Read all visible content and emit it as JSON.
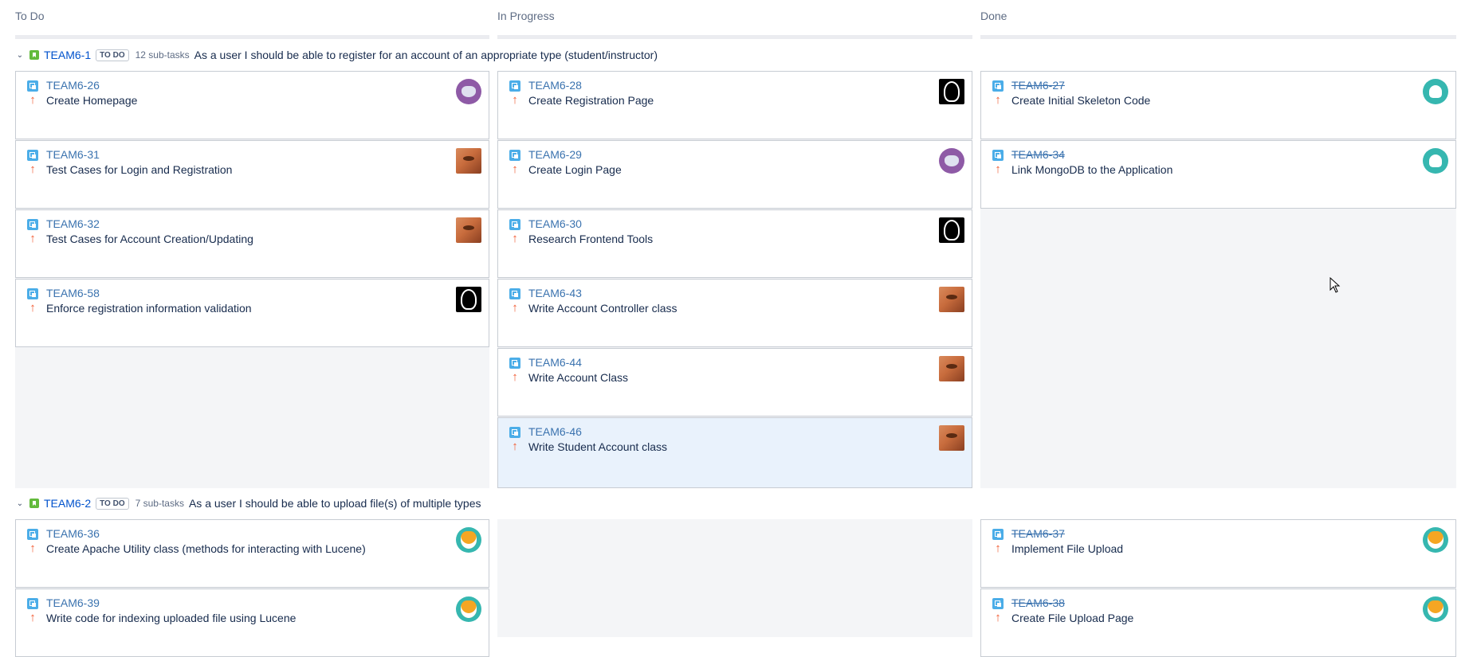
{
  "columns": [
    {
      "title": "To Do"
    },
    {
      "title": "In Progress"
    },
    {
      "title": "Done"
    }
  ],
  "swimlanes": [
    {
      "key": "TEAM6-1",
      "status": "TO DO",
      "subtasks": "12 sub-tasks",
      "summary": "As a user I should be able to register for an account of an appropriate type (student/instructor)"
    },
    {
      "key": "TEAM6-2",
      "status": "TO DO",
      "subtasks": "7 sub-tasks",
      "summary": "As a user I should be able to upload file(s) of multiple types"
    }
  ],
  "lane1": {
    "todo": [
      {
        "key": "TEAM6-26",
        "summary": "Create Homepage",
        "avatar": "cat-avatar"
      },
      {
        "key": "TEAM6-31",
        "summary": "Test Cases for Login and Registration",
        "avatar": "face-photo-avatar"
      },
      {
        "key": "TEAM6-32",
        "summary": "Test Cases for Account Creation/Updating",
        "avatar": "face-photo-avatar"
      },
      {
        "key": "TEAM6-58",
        "summary": "Enforce registration information validation",
        "avatar": "sketch-photo-avatar"
      }
    ],
    "inprogress": [
      {
        "key": "TEAM6-28",
        "summary": "Create Registration Page",
        "avatar": "sketch-photo-avatar"
      },
      {
        "key": "TEAM6-29",
        "summary": "Create Login Page",
        "avatar": "cat-avatar"
      },
      {
        "key": "TEAM6-30",
        "summary": "Research Frontend Tools",
        "avatar": "sketch-photo-avatar"
      },
      {
        "key": "TEAM6-43",
        "summary": "Write Account Controller class",
        "avatar": "face-photo-avatar"
      },
      {
        "key": "TEAM6-44",
        "summary": "Write Account Class",
        "avatar": "face-photo-avatar"
      },
      {
        "key": "TEAM6-46",
        "summary": "Write Student Account class",
        "avatar": "face-photo-avatar"
      }
    ],
    "done": [
      {
        "key": "TEAM6-27",
        "summary": "Create Initial Skeleton Code",
        "avatar": "ghost-avatar"
      },
      {
        "key": "TEAM6-34",
        "summary": "Link MongoDB to the Application",
        "avatar": "ghost-avatar"
      }
    ]
  },
  "lane2": {
    "todo": [
      {
        "key": "TEAM6-36",
        "summary": "Create Apache Utility class (methods for interacting with Lucene)",
        "avatar": "dog-avatar"
      },
      {
        "key": "TEAM6-39",
        "summary": "Write code for indexing uploaded file using Lucene",
        "avatar": "dog-avatar"
      }
    ],
    "done": [
      {
        "key": "TEAM6-37",
        "summary": "Implement File Upload",
        "avatar": "dog-avatar"
      },
      {
        "key": "TEAM6-38",
        "summary": "Create File Upload Page",
        "avatar": "dog-avatar"
      }
    ]
  },
  "colors": {
    "link": "#3b73af",
    "priority_high": "#f15c33",
    "subtask": "#4bade8",
    "story": "#63ba3c",
    "selected_card": "#e9f2fc",
    "column_bg": "#f4f5f7"
  }
}
